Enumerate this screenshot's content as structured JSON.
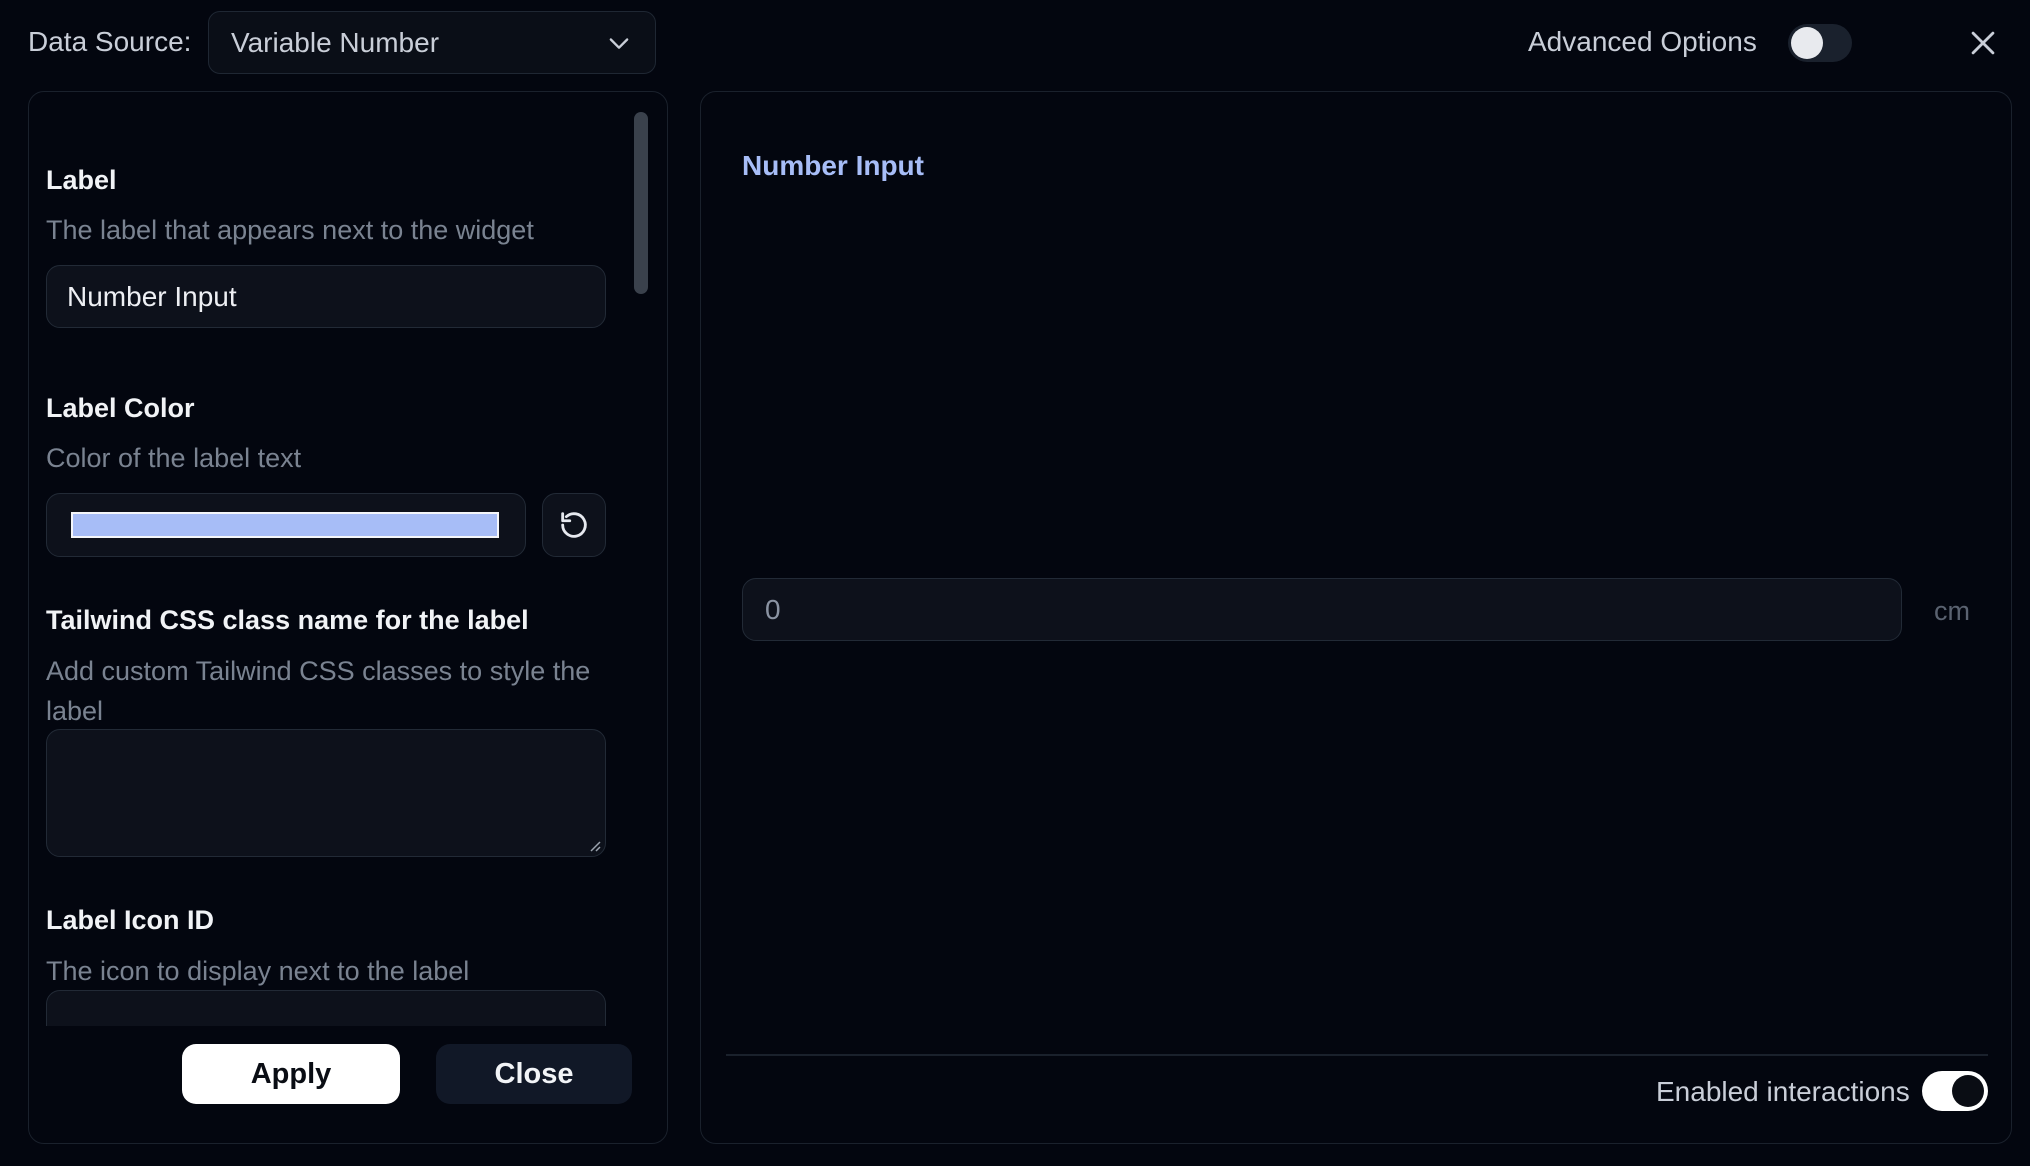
{
  "header": {
    "data_source_label": "Data Source:",
    "data_source_value": "Variable Number",
    "advanced_options_label": "Advanced Options",
    "advanced_options_enabled": false
  },
  "form": {
    "label": {
      "title": "Label",
      "description": "The label that appears next to the widget",
      "value": "Number Input"
    },
    "label_color": {
      "title": "Label Color",
      "description": "Color of the label text",
      "value": "#a7bdf7"
    },
    "label_class": {
      "title": "Tailwind CSS class name for the label",
      "description": "Add custom Tailwind CSS classes to style the label",
      "value": ""
    },
    "label_icon": {
      "title": "Label Icon ID",
      "description": "The icon to display next to the label"
    },
    "apply_label": "Apply",
    "close_label": "Close"
  },
  "preview": {
    "label": "Number Input",
    "value": "0",
    "unit": "cm",
    "enabled_interactions_label": "Enabled interactions",
    "enabled_interactions": true
  },
  "colors": {
    "background": "#03060f",
    "panel_border": "#1a212c",
    "input_bg": "#0d111b",
    "label_color": "#a7bdf7"
  },
  "icons": {
    "dropdown": "chevron-down-icon",
    "close": "close-icon",
    "reset": "reset-icon"
  }
}
